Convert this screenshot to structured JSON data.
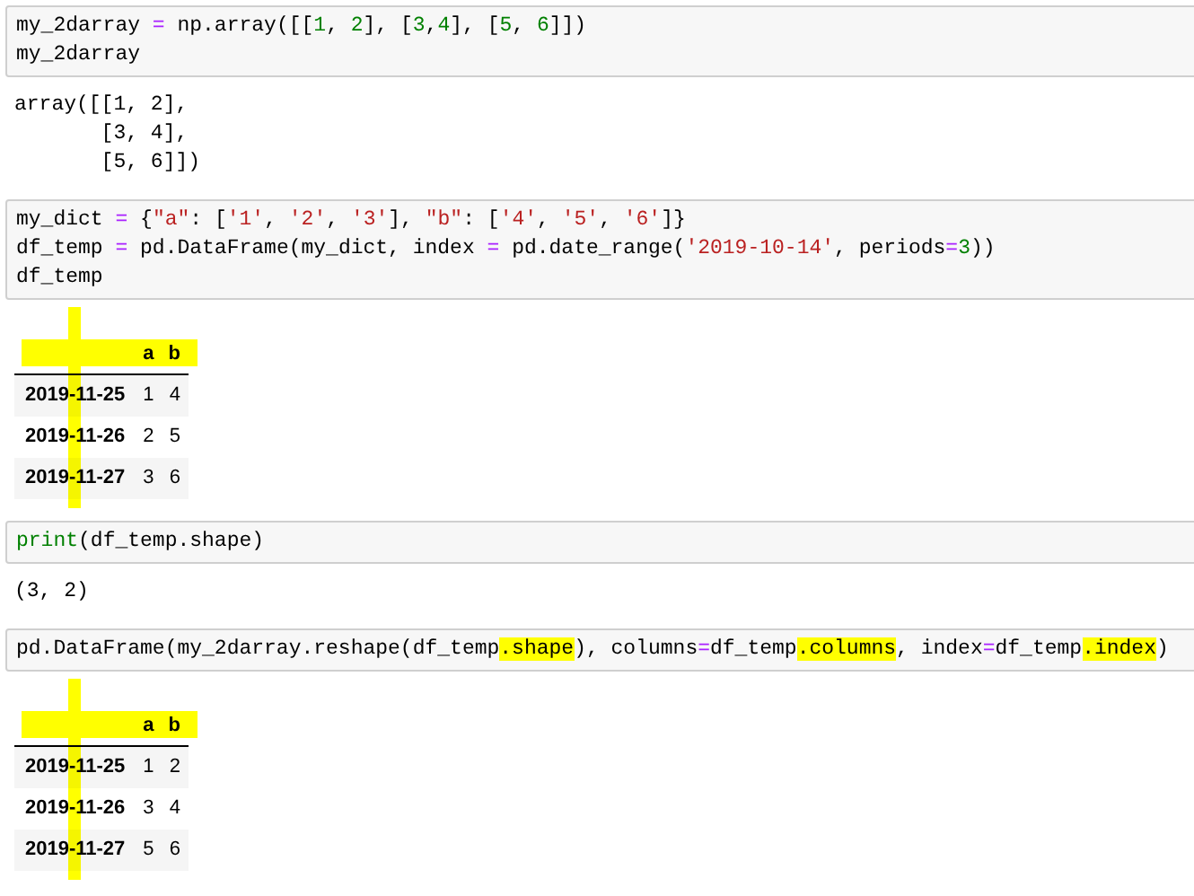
{
  "cells": [
    {
      "kind": "code",
      "lines": [
        [
          {
            "text": "my_2darray ",
            "kind": "plain"
          },
          {
            "text": "=",
            "kind": "operator"
          },
          {
            "text": " np.array([[",
            "kind": "plain"
          },
          {
            "text": "1",
            "kind": "number"
          },
          {
            "text": ", ",
            "kind": "plain"
          },
          {
            "text": "2",
            "kind": "number"
          },
          {
            "text": "], [",
            "kind": "plain"
          },
          {
            "text": "3",
            "kind": "number"
          },
          {
            "text": ",",
            "kind": "plain"
          },
          {
            "text": "4",
            "kind": "number"
          },
          {
            "text": "], [",
            "kind": "plain"
          },
          {
            "text": "5",
            "kind": "number"
          },
          {
            "text": ", ",
            "kind": "plain"
          },
          {
            "text": "6",
            "kind": "number"
          },
          {
            "text": "]])",
            "kind": "plain"
          }
        ],
        [
          {
            "text": "my_2darray",
            "kind": "plain"
          }
        ]
      ]
    },
    {
      "kind": "text_output",
      "lines": [
        "array([[1, 2],",
        "       [3, 4],",
        "       [5, 6]])"
      ]
    },
    {
      "kind": "code",
      "lines": [
        [
          {
            "text": "my_dict ",
            "kind": "plain"
          },
          {
            "text": "=",
            "kind": "operator"
          },
          {
            "text": " {",
            "kind": "plain"
          },
          {
            "text": "\"a\"",
            "kind": "string"
          },
          {
            "text": ": [",
            "kind": "plain"
          },
          {
            "text": "'1'",
            "kind": "string"
          },
          {
            "text": ", ",
            "kind": "plain"
          },
          {
            "text": "'2'",
            "kind": "string"
          },
          {
            "text": ", ",
            "kind": "plain"
          },
          {
            "text": "'3'",
            "kind": "string"
          },
          {
            "text": "], ",
            "kind": "plain"
          },
          {
            "text": "\"b\"",
            "kind": "string"
          },
          {
            "text": ": [",
            "kind": "plain"
          },
          {
            "text": "'4'",
            "kind": "string"
          },
          {
            "text": ", ",
            "kind": "plain"
          },
          {
            "text": "'5'",
            "kind": "string"
          },
          {
            "text": ", ",
            "kind": "plain"
          },
          {
            "text": "'6'",
            "kind": "string"
          },
          {
            "text": "]}",
            "kind": "plain"
          }
        ],
        [
          {
            "text": "df_temp ",
            "kind": "plain"
          },
          {
            "text": "=",
            "kind": "operator"
          },
          {
            "text": " pd.DataFrame(my_dict, index ",
            "kind": "plain"
          },
          {
            "text": "=",
            "kind": "operator"
          },
          {
            "text": " pd.date_range(",
            "kind": "plain"
          },
          {
            "text": "'2019-10-14'",
            "kind": "string"
          },
          {
            "text": ", periods",
            "kind": "plain"
          },
          {
            "text": "=",
            "kind": "operator"
          },
          {
            "text": "3",
            "kind": "number"
          },
          {
            "text": "))",
            "kind": "plain"
          }
        ],
        [
          {
            "text": "df_temp",
            "kind": "plain"
          }
        ]
      ]
    },
    {
      "kind": "table",
      "marker_strokes": true,
      "columns": [
        "a",
        "b"
      ],
      "rows": [
        {
          "index": "2019-11-25",
          "values": [
            "1",
            "4"
          ]
        },
        {
          "index": "2019-11-26",
          "values": [
            "2",
            "5"
          ]
        },
        {
          "index": "2019-11-27",
          "values": [
            "3",
            "6"
          ]
        }
      ]
    },
    {
      "kind": "code",
      "lines": [
        [
          {
            "text": "print",
            "kind": "builtin"
          },
          {
            "text": "(df_temp.shape)",
            "kind": "plain"
          }
        ]
      ]
    },
    {
      "kind": "text_output",
      "lines": [
        "(3, 2)"
      ]
    },
    {
      "kind": "code",
      "lines": [
        [
          {
            "text": "pd.DataFrame(my_2darray.reshape(df_temp",
            "kind": "plain"
          },
          {
            "text": ".shape",
            "kind": "marked"
          },
          {
            "text": "), columns",
            "kind": "plain"
          },
          {
            "text": "=",
            "kind": "operator"
          },
          {
            "text": "df_temp",
            "kind": "plain"
          },
          {
            "text": ".columns",
            "kind": "marked"
          },
          {
            "text": ", index",
            "kind": "plain"
          },
          {
            "text": "=",
            "kind": "operator"
          },
          {
            "text": "df_temp",
            "kind": "plain"
          },
          {
            "text": ".index",
            "kind": "marked"
          },
          {
            "text": ")",
            "kind": "plain"
          }
        ]
      ]
    },
    {
      "kind": "table",
      "marker_strokes": true,
      "columns": [
        "a",
        "b"
      ],
      "rows": [
        {
          "index": "2019-11-25",
          "values": [
            "1",
            "2"
          ]
        },
        {
          "index": "2019-11-26",
          "values": [
            "3",
            "4"
          ]
        },
        {
          "index": "2019-11-27",
          "values": [
            "5",
            "6"
          ]
        }
      ]
    }
  ]
}
